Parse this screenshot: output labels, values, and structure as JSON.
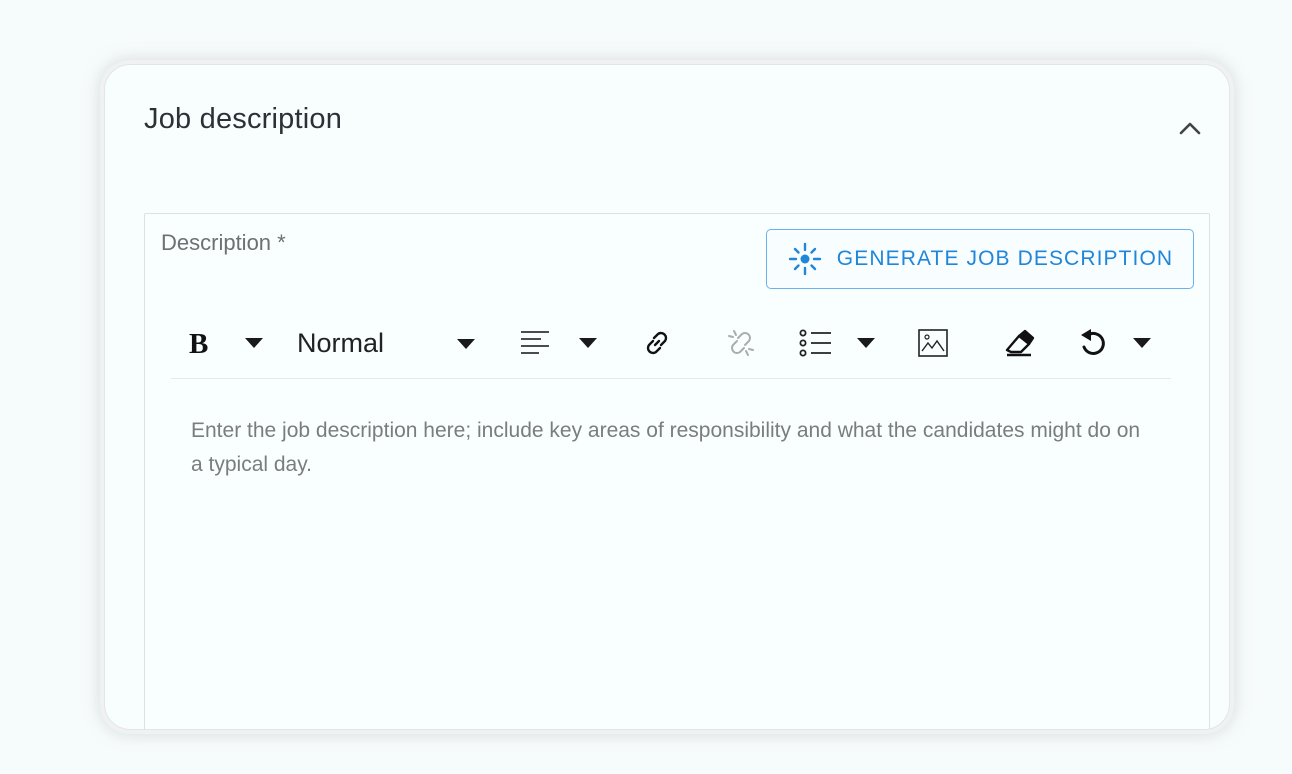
{
  "section": {
    "title": "Job description",
    "collapse_icon": "chevron-up-icon"
  },
  "description_field": {
    "label": "Description *",
    "generate_button": {
      "label": "GENERATE JOB DESCRIPTION",
      "icon": "sparkle-icon",
      "color": "#1f86d8"
    },
    "toolbar": {
      "bold_icon": "bold-icon",
      "heading_value": "Normal",
      "align_icon": "align-left-icon",
      "link_icon": "link-icon",
      "unlink_icon": "unlink-icon",
      "list_icon": "bulleted-list-icon",
      "image_icon": "image-icon",
      "clear_format_icon": "eraser-icon",
      "undo_icon": "undo-icon"
    },
    "editor": {
      "placeholder": "Enter the job description here; include key areas of responsibility and what the candidates might do on a typical day."
    }
  }
}
